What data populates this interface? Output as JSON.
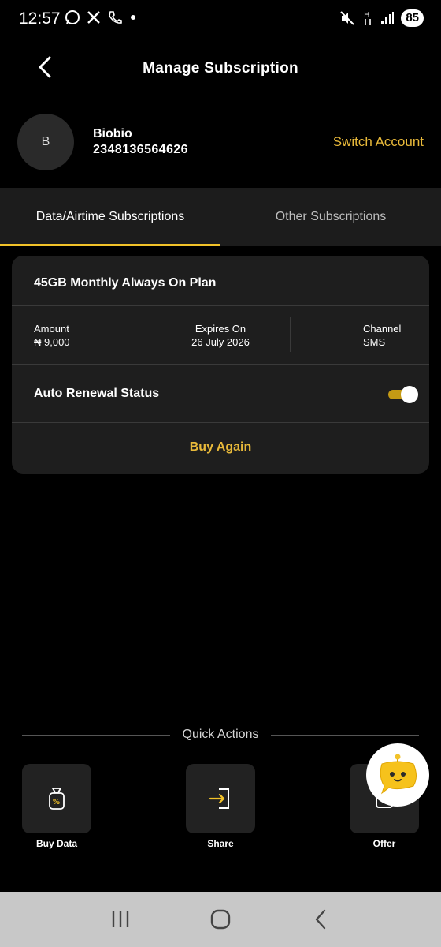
{
  "status_bar": {
    "time": "12:57",
    "battery": "85"
  },
  "header": {
    "title": "Manage Subscription"
  },
  "account": {
    "avatar_initial": "B",
    "name": "Biobio",
    "number": "2348136564626",
    "switch_label": "Switch Account"
  },
  "tabs": [
    {
      "label": "Data/Airtime Subscriptions",
      "active": true
    },
    {
      "label": "Other Subscriptions",
      "active": false
    }
  ],
  "subscription": {
    "plan_name": "45GB Monthly Always On Plan",
    "amount_label": "Amount",
    "amount_value": "₦ 9,000",
    "expires_label": "Expires On",
    "expires_value": "26 July 2026",
    "channel_label": "Channel",
    "channel_value": "SMS",
    "auto_renewal_label": "Auto Renewal Status",
    "auto_renewal_on": true,
    "buy_again_label": "Buy Again"
  },
  "quick_actions": {
    "title": "Quick Actions",
    "items": [
      {
        "label": "Buy Data",
        "icon": "data-bag-icon"
      },
      {
        "label": "Share",
        "icon": "share-arrow-icon"
      },
      {
        "label": "Offer",
        "icon": "offer-icon"
      }
    ]
  },
  "colors": {
    "accent": "#F2C229",
    "background": "#000000",
    "card": "#1E1E1E"
  }
}
